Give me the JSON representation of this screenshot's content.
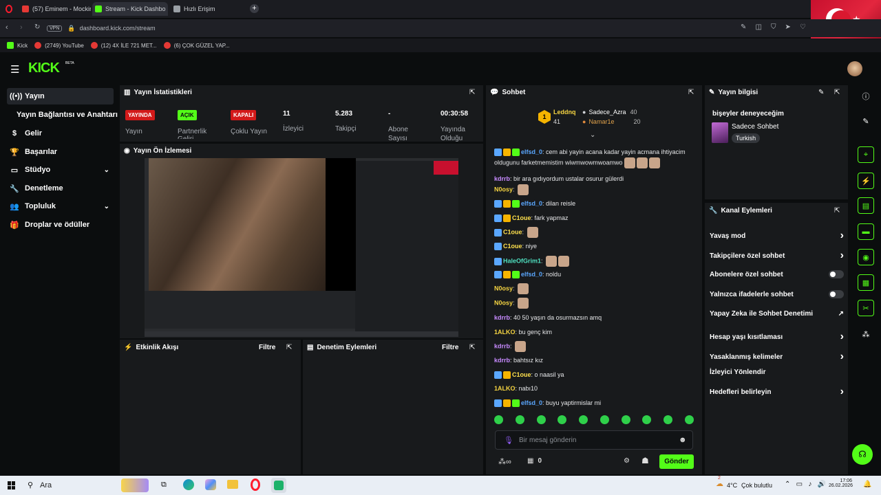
{
  "browser": {
    "tabs": [
      {
        "label": "(57) Eminem - Mockin",
        "favicon_color": "#e53935"
      },
      {
        "label": "Stream - Kick Dashbo",
        "favicon_color": "#53fc18",
        "active": true
      },
      {
        "label": "Hızlı Erişim",
        "favicon_color": "#9aa0a6"
      }
    ],
    "url": "dashboard.kick.com/stream",
    "url_host": "kick.com",
    "vpn": "VPN",
    "bookmarks": [
      {
        "label": "Kick",
        "color": "#53fc18"
      },
      {
        "label": "(2749) YouTube",
        "color": "#e53935"
      },
      {
        "label": "(12) 4X İLE 721 MET...",
        "color": "#e53935"
      },
      {
        "label": "(6) ÇOK GÜZEL YAP...",
        "color": "#e53935"
      }
    ]
  },
  "kick": {
    "logo": "KICK",
    "logo_badge": "BETA",
    "accent": "#53fc18"
  },
  "sidebar": {
    "items": [
      {
        "label": "Yayın",
        "icon": "broadcast-icon",
        "active": true
      },
      {
        "label": "Yayın Bağlantısı ve Anahtarı",
        "icon": ""
      },
      {
        "label": "Gelir",
        "icon": "money-icon"
      },
      {
        "label": "Başarılar",
        "icon": "trophy-icon"
      },
      {
        "label": "Stüdyo",
        "icon": "studio-icon",
        "expand": true
      },
      {
        "label": "Denetleme",
        "icon": "wrench-icon"
      },
      {
        "label": "Topluluk",
        "icon": "people-icon",
        "expand": true
      },
      {
        "label": "Droplar ve ödüller",
        "icon": "gift-icon"
      }
    ]
  },
  "stats": {
    "title": "Yayın İstatistikleri",
    "items": [
      {
        "badge": "YAYINDA",
        "badge_color": "#d31a1a",
        "label": "Yayın"
      },
      {
        "badge": "AÇIK",
        "badge_color": "#53fc18",
        "label": "Partnerlik Geliri"
      },
      {
        "badge": "KAPALI",
        "badge_color": "#d31a1a",
        "label": "Çoklu Yayın"
      },
      {
        "value": "11",
        "label": "İzleyici"
      },
      {
        "value": "5.283",
        "label": "Takipçi"
      },
      {
        "value": "-",
        "label": "Abone Sayısı"
      },
      {
        "value": "00:30:58",
        "label": "Yayında Olduğu"
      }
    ]
  },
  "preview": {
    "title": "Yayın Ön İzlemesi"
  },
  "activity": {
    "title": "Etkinlik Akışı",
    "filter": "Filtre"
  },
  "moderation": {
    "title": "Denetim Eylemleri",
    "filter": "Filtre"
  },
  "chat": {
    "title": "Sohbet",
    "leaderboard": [
      {
        "rank": "1",
        "name": "Leddnq",
        "count": "41"
      },
      {
        "name": "Sadece_Azra",
        "count": "40"
      },
      {
        "name": "Namar1e",
        "count": "20"
      }
    ],
    "messages": [
      {
        "user": "elfsd_0",
        "color": "#5aa7ff",
        "text": "cem abi yayin acana kadar yayin acmana ihtiyacim oldugunu farketmemistim wiwmwowmwoamwo",
        "badges": 3,
        "emotes": 3
      },
      {
        "user": "kdrrb",
        "color": "#c88bff",
        "text": "bir ara gıdıyordum ustalar osurur gülerdi",
        "badges": 0,
        "emotes": 0
      },
      {
        "user": "N0osy",
        "color": "#f5d442",
        "text": "",
        "badges": 0,
        "emotes": 1
      },
      {
        "user": "elfsd_0",
        "color": "#5aa7ff",
        "text": "dilan reisle",
        "badges": 3,
        "emotes": 0
      },
      {
        "user": "C1oue",
        "color": "#ffe14d",
        "text": "fark yapmaz",
        "badges": 2,
        "emotes": 0
      },
      {
        "user": "C1oue",
        "color": "#ffe14d",
        "text": "",
        "badges": 1,
        "emotes": 1
      },
      {
        "user": "C1oue",
        "color": "#ffe14d",
        "text": "niye",
        "badges": 1,
        "emotes": 0
      },
      {
        "user": "HaleOfGrim1",
        "color": "#4fe0c0",
        "text": "",
        "badges": 1,
        "emotes": 2
      },
      {
        "user": "elfsd_0",
        "color": "#5aa7ff",
        "text": "noldu",
        "badges": 3,
        "emotes": 0
      },
      {
        "user": "N0osy",
        "color": "#f5d442",
        "text": "",
        "badges": 0,
        "emotes": 1
      },
      {
        "user": "N0osy",
        "color": "#f5d442",
        "text": "",
        "badges": 0,
        "emotes": 1
      },
      {
        "user": "kdrrb",
        "color": "#c88bff",
        "text": "40 50 yaşın da osurmazsın amq",
        "badges": 0,
        "emotes": 0
      },
      {
        "user": "1ALKO",
        "color": "#f5d442",
        "text": "bu genç kim",
        "badges": 0,
        "emotes": 0
      },
      {
        "user": "kdrrb",
        "color": "#c88bff",
        "text": "",
        "badges": 0,
        "emotes": 1
      },
      {
        "user": "kdrrb",
        "color": "#c88bff",
        "text": "bahtsız kız",
        "badges": 0,
        "emotes": 0
      },
      {
        "user": "C1oue",
        "color": "#ffe14d",
        "text": "o naasil ya",
        "badges": 2,
        "emotes": 0
      },
      {
        "user": "1ALKO",
        "color": "#f5d442",
        "text": "nabı10",
        "badges": 0,
        "emotes": 0
      },
      {
        "user": "elfsd_0",
        "color": "#5aa7ff",
        "text": "buyu yaptirmislar mi",
        "badges": 3,
        "emotes": 0
      }
    ],
    "input_placeholder": "Bir mesaj gönderin",
    "points": "0",
    "send": "Gönder"
  },
  "stream_info": {
    "title": "Yayın bilgisi",
    "stream_title": "bişeyler deneyeceğim",
    "category": "Sadece Sohbet",
    "tag": "Turkish"
  },
  "channel_actions": {
    "title": "Kanal Eylemleri",
    "items": [
      {
        "label": "Yavaş mod",
        "control": "chevron"
      },
      {
        "label": "Takipçilere özel sohbet",
        "control": "chevron"
      },
      {
        "label": "Abonelere özel sohbet",
        "control": "toggle"
      },
      {
        "label": "Yalnızca ifadelerle sohbet",
        "control": "toggle"
      },
      {
        "label": "Yapay Zeka ile Sohbet Denetimi",
        "control": "external"
      },
      {
        "label": "Hesap yaşı kısıtlaması",
        "control": "chevron"
      },
      {
        "label": "Yasaklanmış kelimeler",
        "control": "chevron"
      },
      {
        "label": "İzleyici Yönlendir",
        "control": "none"
      },
      {
        "label": "Hedefleri belirleyin",
        "control": "chevron"
      }
    ]
  },
  "taskbar": {
    "search": "Ara",
    "weather_temp": "4°C",
    "weather_text": "Çok bulutlu",
    "weather_badge": "2",
    "time": "17:06",
    "date": "26.02.2026"
  }
}
